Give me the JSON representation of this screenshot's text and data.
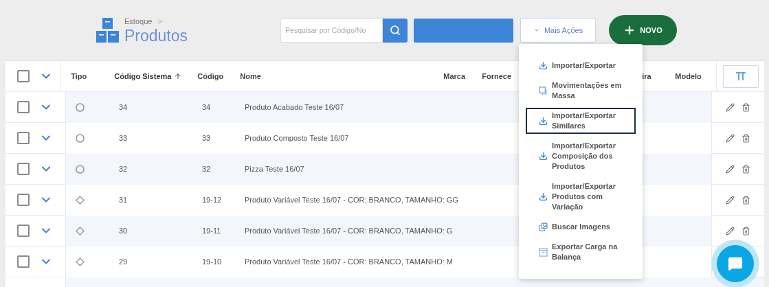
{
  "breadcrumb": {
    "parent": "Estoque",
    "separator": ">"
  },
  "title": "Produtos",
  "search": {
    "placeholder": "Pesquisar por Código/No"
  },
  "more_actions": {
    "label": "Mais Ações",
    "expanded": true
  },
  "new_button": {
    "label": "NOVO"
  },
  "table": {
    "columns": [
      {
        "label": "Tipo",
        "sorted": false
      },
      {
        "label": "Código Sistema",
        "sorted": true
      },
      {
        "label": "Código",
        "sorted": false
      },
      {
        "label": "Nome",
        "sorted": false
      },
      {
        "label": "Marca",
        "sorted": false
      },
      {
        "label": "Fornece",
        "sorted": false
      },
      {
        "label": "ira",
        "sorted": false
      },
      {
        "label": "Modelo",
        "sorted": false
      }
    ],
    "all_checked": false,
    "rows": [
      {
        "kind": "circle",
        "checked": false,
        "system_code": "34",
        "code": "34",
        "name": "Produto Acabado Teste 16/07"
      },
      {
        "kind": "circle",
        "checked": false,
        "system_code": "33",
        "code": "33",
        "name": "Produto Composto Teste 16/07"
      },
      {
        "kind": "circle",
        "checked": false,
        "system_code": "32",
        "code": "32",
        "name": "Pizza Teste 16/07"
      },
      {
        "kind": "diamond",
        "checked": false,
        "system_code": "31",
        "code": "19-12",
        "name": "Produto Variável Teste 16/07 - COR: BRANCO, TAMANHO: GG"
      },
      {
        "kind": "diamond",
        "checked": false,
        "system_code": "30",
        "code": "19-11",
        "name": "Produto Variável Teste 16/07 - COR: BRANCO, TAMANHO: G"
      },
      {
        "kind": "diamond",
        "checked": false,
        "system_code": "29",
        "code": "19-10",
        "name": "Produto Variável Teste 16/07 - COR: BRANCO, TAMANHO: M"
      }
    ]
  },
  "menu": {
    "items": [
      {
        "kind": "download",
        "label": "Importar/Exportar",
        "selected": false
      },
      {
        "kind": "bulk",
        "label": "Movimentações em Massa",
        "selected": false
      },
      {
        "kind": "download",
        "label": "Importar/Exportar Similares",
        "selected": true
      },
      {
        "kind": "download",
        "label": "Importar/Exportar Composição dos Produtos",
        "selected": false
      },
      {
        "kind": "download",
        "label": "Importar/Exportar Produtos com Variação",
        "selected": false
      },
      {
        "kind": "images",
        "label": "Buscar Imagens",
        "selected": false
      },
      {
        "kind": "scale",
        "label": "Exportar Carga na Balança",
        "selected": false
      }
    ]
  }
}
